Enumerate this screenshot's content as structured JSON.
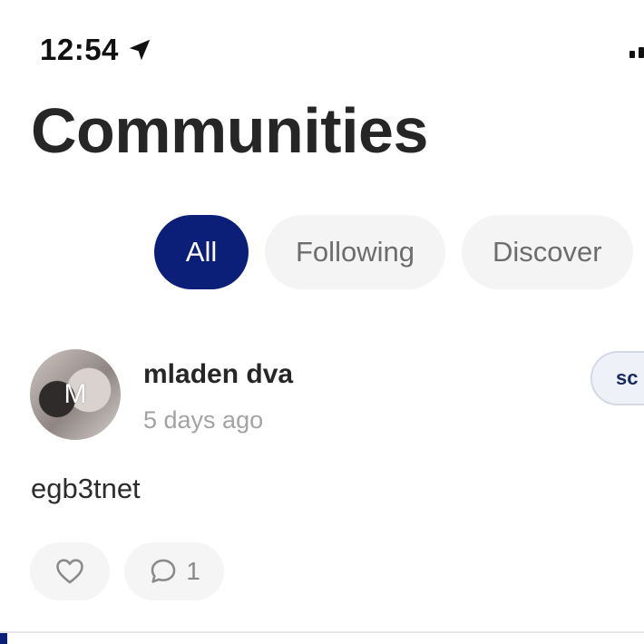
{
  "status_bar": {
    "time": "12:54"
  },
  "header": {
    "title": "Communities"
  },
  "tabs": [
    {
      "label": "All",
      "active": true
    },
    {
      "label": "Following",
      "active": false
    },
    {
      "label": "Discover",
      "active": false
    }
  ],
  "post": {
    "avatar_initial": "M",
    "author": "mladen dva",
    "time_ago": "5 days ago",
    "community_chip": "sc",
    "body": "egb3tnet",
    "comment_count": "1"
  },
  "colors": {
    "accent": "#0b1f78",
    "chip_bg": "#f4f4f4"
  },
  "icons": [
    "location-arrow-icon",
    "signal-icon",
    "heart-icon",
    "comment-icon"
  ]
}
